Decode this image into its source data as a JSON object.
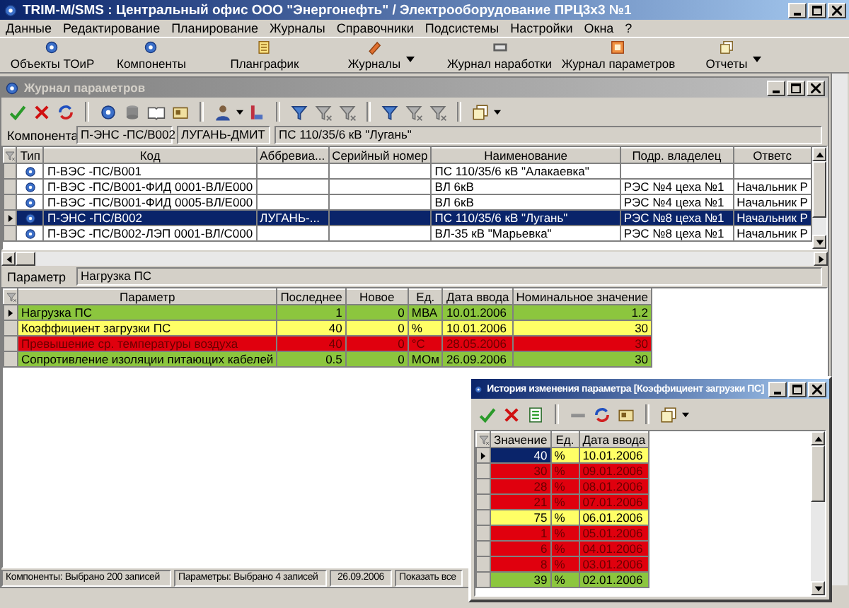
{
  "window": {
    "title": "TRIM-M/SMS : Центральный офис ООО \"Энергонефть\" / Электрооборудование ПРЦ3х3 №1"
  },
  "menu": [
    "Данные",
    "Редактирование",
    "Планирование",
    "Журналы",
    "Справочники",
    "Подсистемы",
    "Настройки",
    "Окна",
    "?"
  ],
  "toolbar": [
    {
      "label": "Объекты ТОиР",
      "has_menu": false
    },
    {
      "label": "Компоненты",
      "has_menu": false
    },
    {
      "label": "Планграфик",
      "has_menu": false
    },
    {
      "label": "Журналы",
      "has_menu": true
    },
    {
      "label": "Журнал наработки",
      "has_menu": false
    },
    {
      "label": "Журнал параметров",
      "has_menu": false
    },
    {
      "label": "Отчеты",
      "has_menu": true
    }
  ],
  "journal_window": {
    "title": "Журнал параметров",
    "active": false,
    "component": {
      "label": "Компонента",
      "code": "П-ЭНС -ПС/В002",
      "abbreviation": "ЛУГАНЬ-ДМИТ",
      "name": "ПС 110/35/6 кВ \"Лугань\""
    },
    "components_table": {
      "columns": [
        "Тип",
        "Код",
        "Аббревиа...",
        "Серийный номер",
        "Наименование",
        "Подр. владелец",
        "Ответс"
      ],
      "rows": [
        {
          "selected": false,
          "cells": [
            "",
            "П-ВЭС -ПС/В001",
            null,
            null,
            "ПС 110/35/6 кВ \"Алакаевка\"",
            null,
            null
          ]
        },
        {
          "selected": false,
          "cells": [
            "",
            "П-ВЭС -ПС/В001-ФИД 0001-ВЛ/Е000",
            null,
            null,
            "ВЛ 6кВ",
            "РЭС №4 цеха №1",
            "Начальник Р"
          ]
        },
        {
          "selected": false,
          "cells": [
            "",
            "П-ВЭС -ПС/В001-ФИД 0005-ВЛ/Е000",
            null,
            null,
            "ВЛ 6кВ",
            "РЭС №4 цеха №1",
            "Начальник Р"
          ]
        },
        {
          "selected": true,
          "cells": [
            "",
            "П-ЭНС -ПС/В002",
            "ЛУГАНЬ-...",
            null,
            "ПС 110/35/6 кВ \"Лугань\"",
            "РЭС №8 цеха №1",
            "Начальник Р"
          ]
        },
        {
          "selected": false,
          "cells": [
            "",
            "П-ВЭС -ПС/В002-ЛЭП 0001-ВЛ/С000",
            null,
            null,
            "ВЛ-35 кВ \"Марьевка\"",
            "РЭС №8 цеха №1",
            "Начальник Р"
          ]
        }
      ]
    },
    "parameter": {
      "label": "Параметр",
      "value": "Нагрузка ПС"
    },
    "parameters_table": {
      "columns": [
        "Параметр",
        "Последнее",
        "Новое",
        "Ед.",
        "Дата ввода",
        "Номинальное значение"
      ],
      "rows": [
        {
          "selected": true,
          "color": "#8cc63e",
          "cells": [
            "Нагрузка ПС",
            "1",
            "0",
            "МВА",
            "10.01.2006",
            "1.2"
          ]
        },
        {
          "selected": false,
          "color": "#ffff66",
          "cells": [
            "Коэффициент загрузки ПС",
            "40",
            "0",
            "%",
            "10.01.2006",
            "30"
          ]
        },
        {
          "selected": false,
          "color": "#e0000e",
          "cells": [
            "Превышение ср. температуры воздуха",
            "40",
            "0",
            "°С",
            "28.05.2006",
            "30"
          ]
        },
        {
          "selected": false,
          "color": "#8cc63e",
          "cells": [
            "Сопротивление изоляции питающих кабелей",
            "0.5",
            "0",
            "МОм",
            "26.09.2006",
            "30"
          ]
        }
      ]
    },
    "status_bar": [
      "Компоненты: Выбрано 200 записей",
      "Параметры: Выбрано 4 записей",
      "26.09.2006",
      "Показать все"
    ]
  },
  "history_window": {
    "title": "История изменения параметра [Коэффициент загрузки ПС]",
    "active": true,
    "table": {
      "columns": [
        "Значение",
        "Ед.",
        "Дата ввода"
      ],
      "rows": [
        {
          "selected": true,
          "color": "#ffff66",
          "cells": [
            "40",
            "%",
            "10.01.2006"
          ]
        },
        {
          "selected": false,
          "color": "#e0000e",
          "cells": [
            "30",
            "%",
            "09.01.2006"
          ]
        },
        {
          "selected": false,
          "color": "#e0000e",
          "cells": [
            "28",
            "%",
            "08.01.2006"
          ]
        },
        {
          "selected": false,
          "color": "#e0000e",
          "cells": [
            "21",
            "%",
            "07.01.2006"
          ]
        },
        {
          "selected": false,
          "color": "#ffff66",
          "cells": [
            "75",
            "%",
            "06.01.2006"
          ]
        },
        {
          "selected": false,
          "color": "#e0000e",
          "cells": [
            "1",
            "%",
            "05.01.2006"
          ]
        },
        {
          "selected": false,
          "color": "#e0000e",
          "cells": [
            "6",
            "%",
            "04.01.2006"
          ]
        },
        {
          "selected": false,
          "color": "#e0000e",
          "cells": [
            "8",
            "%",
            "03.01.2006"
          ]
        },
        {
          "selected": false,
          "color": "#8cc63e",
          "cells": [
            "39",
            "%",
            "02.01.2006"
          ]
        }
      ]
    }
  }
}
